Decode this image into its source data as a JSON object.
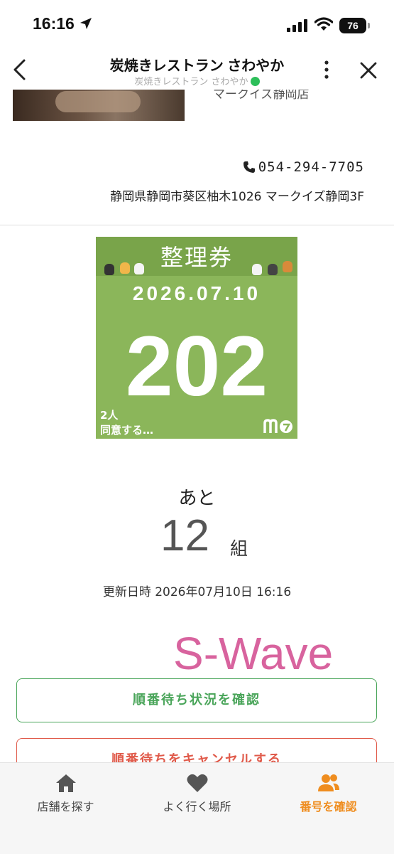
{
  "status": {
    "time": "16:16",
    "battery": "76"
  },
  "nav": {
    "title": "炭焼きレストラン さわやか",
    "subtitle": "炭焼きレストラン さわやか"
  },
  "store": {
    "hero_text": "マークイズ静岡店",
    "phone": "054-294-7705",
    "address": "静岡県静岡市葵区柚木1026 マークイズ静岡3F"
  },
  "ticket": {
    "title": "整理券",
    "date": "2026.07.10",
    "number": "202",
    "people": "2人",
    "note": "同意する…",
    "colors": {
      "background": "#8bb65a",
      "header": "#79a44a"
    }
  },
  "wait": {
    "label": "あと",
    "count": "12",
    "unit": "組"
  },
  "updated": "更新日時 2026年07月10日 16:16",
  "brand": "S-Wave",
  "buttons": {
    "check": "順番待ち状況を確認",
    "cancel": "順番待ちをキャンセルする"
  },
  "tabs": [
    {
      "label": "店舗を探す",
      "icon": "home-icon"
    },
    {
      "label": "よく行く場所",
      "icon": "heart-icon"
    },
    {
      "label": "番号を確認",
      "icon": "people-icon"
    }
  ],
  "accent_color": "#ef8d1f"
}
